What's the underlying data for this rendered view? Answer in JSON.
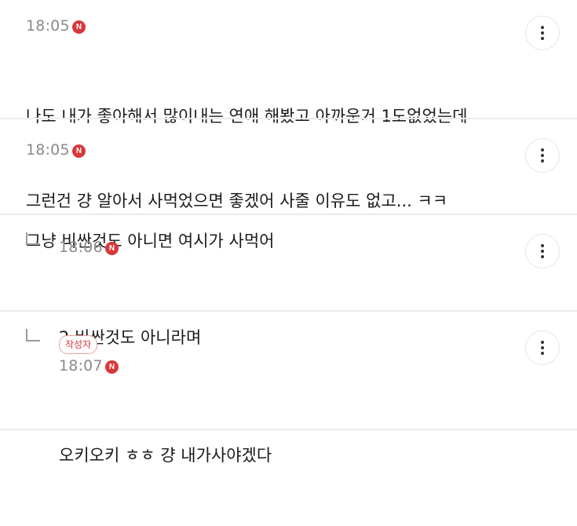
{
  "comments": [
    {
      "time": "18:05",
      "badge": "N",
      "lines": [
        "나도 내가 좋아해서 많이내는 연애 해봤고 아까운거 1도없었는데",
        "그런건 걍 알아서 사먹었으면 좋겠어 사줄 이유도 없고... ㅋㅋ"
      ]
    },
    {
      "time": "18:05",
      "badge": "N",
      "lines": [
        "그냥 비싼것도 아니면 여시가 사먹어"
      ]
    },
    {
      "time": "18:06",
      "badge": "N",
      "lines": [
        "2 비싼것도 아니라며"
      ]
    },
    {
      "author_tag": "작성자",
      "time": "18:07",
      "badge": "N",
      "lines": [
        "오키오키 ㅎㅎ 걍 내가사야겠다"
      ]
    }
  ]
}
